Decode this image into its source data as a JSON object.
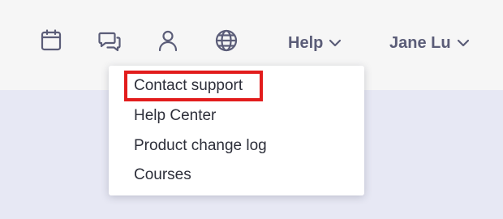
{
  "header": {
    "icons": [
      "calendar-icon",
      "chat-icon",
      "user-icon",
      "globe-icon"
    ],
    "help_label": "Help",
    "user_name": "Jane Lu"
  },
  "help_menu": {
    "items": [
      {
        "label": "Contact support"
      },
      {
        "label": "Help Center"
      },
      {
        "label": "Product change log"
      },
      {
        "label": "Courses"
      }
    ]
  },
  "colors": {
    "header_bg": "#f6f6f6",
    "page_bg": "#e7e8f4",
    "nav_text": "#5b5d78",
    "highlight": "#e21c1c"
  }
}
